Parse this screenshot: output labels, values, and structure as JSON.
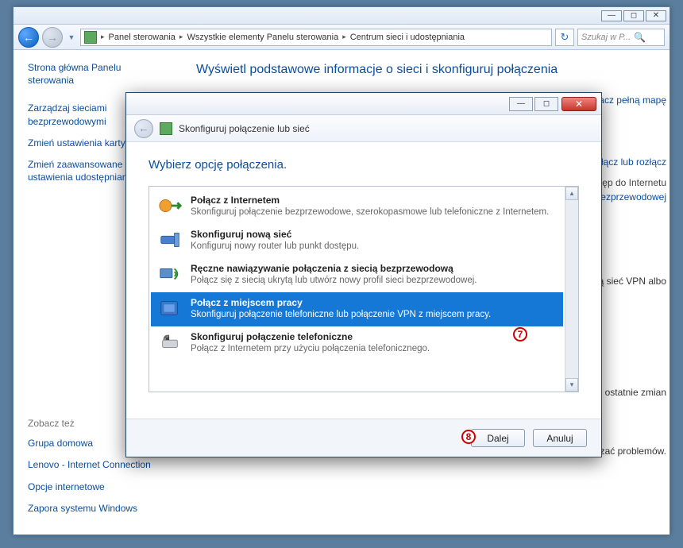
{
  "window": {
    "breadcrumb": [
      "Panel sterowania",
      "Wszystkie elementy Panelu sterowania",
      "Centrum sieci i udostępniania"
    ],
    "search_placeholder": "Szukaj w P..."
  },
  "sidebar": {
    "heading": "Strona główna Panelu sterowania",
    "links": [
      "Zarządzaj sieciami bezprzewodowymi",
      "Zmień ustawienia karty sieciowej",
      "Zmień zaawansowane ustawienia udostępniania"
    ],
    "see_also_heading": "Zobacz też",
    "see_also": [
      "Grupa domowa",
      "Lenovo - Internet Connection",
      "Opcje internetowe",
      "Zapora systemu Windows"
    ]
  },
  "main": {
    "heading": "Wyświetl podstawowe informacje o sieci i skonfiguruj połączenia",
    "map_link": "Zobacz pełną mapę",
    "frag_connect": "Połącz lub rozłącz",
    "frag_internet": "Dostęp do Internetu",
    "frag_wireless": "Połączenie sieci bezprzewodowej",
    "frag_change": "Pokazuje ostatnie zmian",
    "frag_new": "nową sieć VPN albo",
    "frag_problems": "rozwiązać problemów."
  },
  "wizard": {
    "title": "Skonfiguruj połączenie lub sieć",
    "heading": "Wybierz opcję połączenia.",
    "options": [
      {
        "title": "Połącz z Internetem",
        "desc": "Skonfiguruj połączenie bezprzewodowe, szerokopasmowe lub telefoniczne z Internetem."
      },
      {
        "title": "Skonfiguruj nową sieć",
        "desc": "Konfiguruj nowy router lub punkt dostępu."
      },
      {
        "title": "Ręczne nawiązywanie połączenia z siecią bezprzewodową",
        "desc": "Połącz się z siecią ukrytą lub utwórz nowy profil sieci bezprzewodowej."
      },
      {
        "title": "Połącz z miejscem pracy",
        "desc": "Skonfiguruj połączenie telefoniczne lub połączenie VPN z miejscem pracy."
      },
      {
        "title": "Skonfiguruj połączenie telefoniczne",
        "desc": "Połącz z Internetem przy użyciu połączenia telefonicznego."
      }
    ],
    "selected_index": 3,
    "next": "Dalej",
    "cancel": "Anuluj"
  },
  "annotations": {
    "seven": "7",
    "eight": "8"
  }
}
